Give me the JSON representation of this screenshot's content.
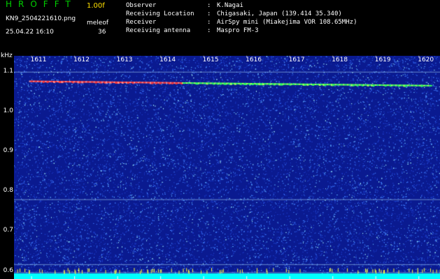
{
  "header": {
    "logo": "HROFFT",
    "version": "1.00f",
    "filename": "KN9_2504221610.png",
    "meleo_label": "meleof",
    "timestamp": "25.04.22 16:10",
    "count": "36",
    "info": [
      {
        "label": "Observer",
        "value": "K.Nagai"
      },
      {
        "label": "Receiving Location",
        "value": "Chigasaki, Japan (139.414 35.340)"
      },
      {
        "label": "Receiver",
        "value": "AirSpy mini (Miakejima VOR 108.65MHz)"
      },
      {
        "label": "Receiving antenna",
        "value": "Maspro FM-3"
      }
    ],
    "separator": ":"
  },
  "axes": {
    "y_unit": "kHz",
    "y_ticks": [
      "1.1",
      "1.0",
      "0.9",
      "0.8",
      "0.7",
      "0.6"
    ],
    "x_ticks": [
      "1611",
      "1612",
      "1613",
      "1614",
      "1615",
      "1616",
      "1617",
      "1618",
      "1619",
      "1620"
    ]
  },
  "colors": {
    "background": "#0a1a90",
    "noise": "#3f7cff",
    "carrier_red": "#ff3a3a",
    "carrier_green": "#30ff60",
    "baseline": "#00ffff",
    "logo": "#00d000",
    "version": "#ffe000"
  },
  "chart_data": {
    "type": "heatmap",
    "xlabel": "",
    "ylabel": "kHz",
    "x_ticks": [
      "1611",
      "1612",
      "1613",
      "1614",
      "1615",
      "1616",
      "1617",
      "1618",
      "1619",
      "1620"
    ],
    "ylim": [
      0.58,
      1.14
    ],
    "y_ticks": [
      1.1,
      1.0,
      0.9,
      0.8,
      0.7,
      0.6
    ],
    "carrier_line": {
      "x_start": 1610.95,
      "x_end": 1620.3,
      "y_start": 1.076,
      "y_end": 1.065
    },
    "faint_lines_y": [
      1.1,
      0.78,
      0.617,
      0.597
    ]
  }
}
